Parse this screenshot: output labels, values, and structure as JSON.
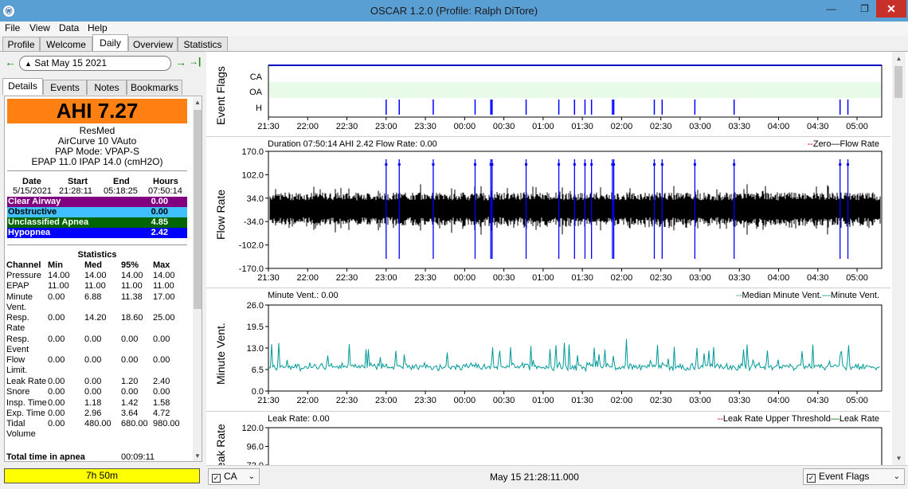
{
  "window": {
    "title": "OSCAR 1.2.0 (Profile: Ralph DiTore)",
    "minimize": "—",
    "maximize": "❐",
    "close": "✕"
  },
  "menu": [
    "File",
    "View",
    "Data",
    "Help"
  ],
  "main_tabs": [
    "Profile",
    "Welcome",
    "Daily",
    "Overview",
    "Statistics"
  ],
  "main_tab_active": "Daily",
  "date_nav": {
    "prev": "←",
    "date": "Sat May 15 2021",
    "next": "→",
    "last": "→|"
  },
  "sub_tabs": [
    "Details",
    "Events",
    "Notes",
    "Bookmarks"
  ],
  "details": {
    "ahi": "AHI 7.27",
    "ahi_color": "#ff8012",
    "device_lines": [
      "ResMed",
      "AirCurve 10 VAuto",
      "PAP Mode: VPAP-S",
      "EPAP 11.0 IPAP 14.0 (cmH2O)"
    ],
    "session_headers": [
      "Date",
      "Start",
      "End",
      "Hours"
    ],
    "session_values": [
      "5/15/2021",
      "21:28:11",
      "05:18:25",
      "07:50:14"
    ],
    "events": [
      {
        "label": "Clear Airway",
        "value": "0.00",
        "color": "#800080",
        "text": "#ffffff"
      },
      {
        "label": "Obstructive",
        "value": "0.00",
        "color": "#40c0ff",
        "text": "#000000"
      },
      {
        "label": "Unclassified Apnea",
        "value": "4.85",
        "color": "#006400",
        "text": "#ffffff"
      },
      {
        "label": "Hypopnea",
        "value": "2.42",
        "color": "#0000ff",
        "text": "#ffffff"
      }
    ],
    "stats_title": "Statistics",
    "stats_headers": [
      "Channel",
      "Min",
      "Med",
      "95%",
      "Max"
    ],
    "stats_rows": [
      [
        "Pressure",
        "14.00",
        "14.00",
        "14.00",
        "14.00"
      ],
      [
        "EPAP",
        "11.00",
        "11.00",
        "11.00",
        "11.00"
      ],
      [
        "Minute\nVent.",
        "0.00",
        "6.88",
        "11.38",
        "17.00"
      ],
      [
        "Resp.\nRate",
        "0.00",
        "14.20",
        "18.60",
        "25.00"
      ],
      [
        "Resp.\nEvent",
        "0.00",
        "0.00",
        "0.00",
        "0.00"
      ],
      [
        "Flow\nLimit.",
        "0.00",
        "0.00",
        "0.00",
        "0.00"
      ],
      [
        "Leak Rate",
        "0.00",
        "0.00",
        "1.20",
        "2.40"
      ],
      [
        "Snore",
        "0.00",
        "0.00",
        "0.00",
        "0.00"
      ],
      [
        "Insp. Time",
        "0.00",
        "1.18",
        "1.42",
        "1.58"
      ],
      [
        "Exp. Time",
        "0.00",
        "2.96",
        "3.64",
        "4.72"
      ],
      [
        "Tidal\nVolume",
        "0.00",
        "480.00",
        "680.00",
        "980.00"
      ]
    ],
    "total_apnea_label": "Total time in apnea",
    "total_apnea_value": "00:09:11"
  },
  "duration_bar": "7h 50m",
  "time_ticks": [
    "21:30",
    "22:00",
    "22:30",
    "23:00",
    "23:30",
    "00:00",
    "00:30",
    "01:00",
    "01:30",
    "02:00",
    "02:30",
    "03:00",
    "03:30",
    "04:00",
    "04:30",
    "05:00"
  ],
  "graphs": {
    "event_flags": {
      "ylabel": "Event Flags",
      "rows": [
        "CA",
        "OA",
        "H"
      ],
      "hypopnea_times": [
        "23:00",
        "23:10",
        "23:36",
        "00:08",
        "00:20",
        "00:21",
        "00:47",
        "01:12",
        "01:24",
        "01:32",
        "01:37",
        "01:53",
        "01:54",
        "02:25",
        "02:31",
        "02:56",
        "03:26",
        "04:47",
        "04:53"
      ]
    },
    "flow_rate": {
      "ylabel": "Flow Rate",
      "title": "Duration 07:50:14 AHI 2.42 Flow Rate: 0.00",
      "legend": [
        "Zero",
        "Flow Rate"
      ],
      "yticks": [
        "170.0",
        "102.0",
        "34.0",
        "-34.0",
        "-102.0",
        "-170.0"
      ]
    },
    "minute_vent": {
      "ylabel": "Minute Vent.",
      "title": "Minute Vent.: 0.00",
      "legend": [
        "Median Minute Vent.",
        "Minute Vent."
      ],
      "yticks": [
        "26.0",
        "19.5",
        "13.0",
        "6.5",
        "0.0"
      ],
      "color": "#009999"
    },
    "leak_rate": {
      "ylabel": "Leak Rate",
      "title": "Leak Rate: 0.00",
      "legend": [
        "Leak Rate Upper Threshold",
        "Leak Rate"
      ],
      "yticks": [
        "120.0",
        "96.0",
        "72.0"
      ]
    }
  },
  "bottom": {
    "left_combo": "CA",
    "time": "May 15 21:28:11.000",
    "right_combo": "Event Flags"
  },
  "chart_data": [
    {
      "type": "scatter",
      "title": "",
      "ylabel": "Event Flags",
      "x": [
        "23:00",
        "23:10",
        "23:36",
        "00:08",
        "00:20",
        "00:21",
        "00:47",
        "01:12",
        "01:24",
        "01:32",
        "01:37",
        "01:53",
        "01:54",
        "02:25",
        "02:31",
        "02:56",
        "03:26",
        "04:47",
        "04:53"
      ],
      "series": [
        {
          "name": "H"
        }
      ]
    },
    {
      "type": "line",
      "title": "Duration 07:50:14 AHI 2.42 Flow Rate: 0.00",
      "ylabel": "Flow Rate",
      "ylim": [
        -170,
        170
      ],
      "series": [
        {
          "name": "Flow Rate"
        },
        {
          "name": "Zero"
        }
      ]
    },
    {
      "type": "line",
      "title": "Minute Vent.: 0.00",
      "ylabel": "Minute Vent.",
      "ylim": [
        0,
        26
      ],
      "series": [
        {
          "name": "Minute Vent."
        },
        {
          "name": "Median Minute Vent."
        }
      ]
    },
    {
      "type": "line",
      "title": "Leak Rate: 0.00",
      "ylabel": "Leak Rate",
      "series": [
        {
          "name": "Leak Rate"
        },
        {
          "name": "Leak Rate Upper Threshold"
        }
      ]
    }
  ]
}
